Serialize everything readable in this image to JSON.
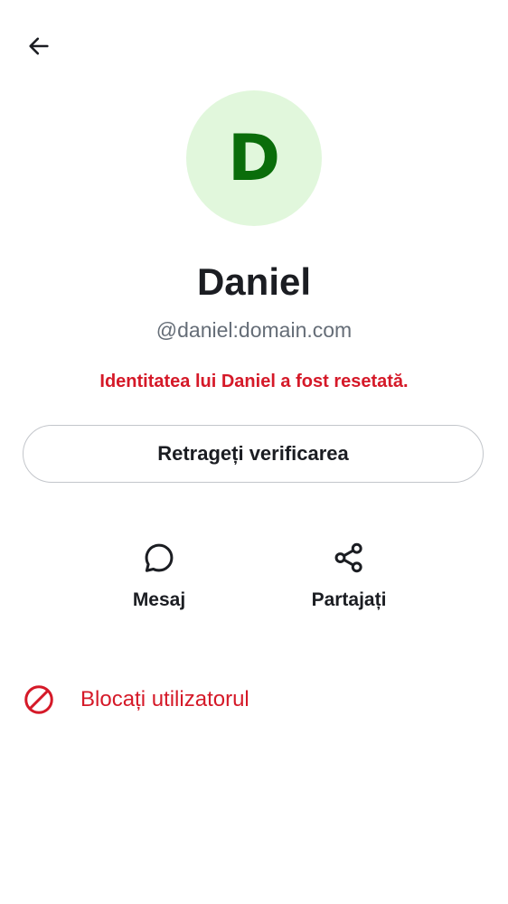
{
  "header": {
    "back_icon": "arrow-left-icon"
  },
  "profile": {
    "avatar_letter": "D",
    "avatar_bg": "#e1f7dc",
    "avatar_fg": "#0a6d0a",
    "name": "Daniel",
    "user_id": "@daniel:domain.com",
    "identity_reset_notice": "Identitatea lui Daniel a fost resetată."
  },
  "buttons": {
    "withdraw_verification": "Retrageți verificarea"
  },
  "actions": [
    {
      "label": "Mesaj",
      "icon": "chat-bubble-icon"
    },
    {
      "label": "Partajați",
      "icon": "share-icon"
    }
  ],
  "block": {
    "label": "Blocați utilizatorul",
    "icon": "block-icon"
  },
  "colors": {
    "critical": "#d51928",
    "text_primary": "#1b1d22",
    "text_secondary": "#656d77"
  }
}
